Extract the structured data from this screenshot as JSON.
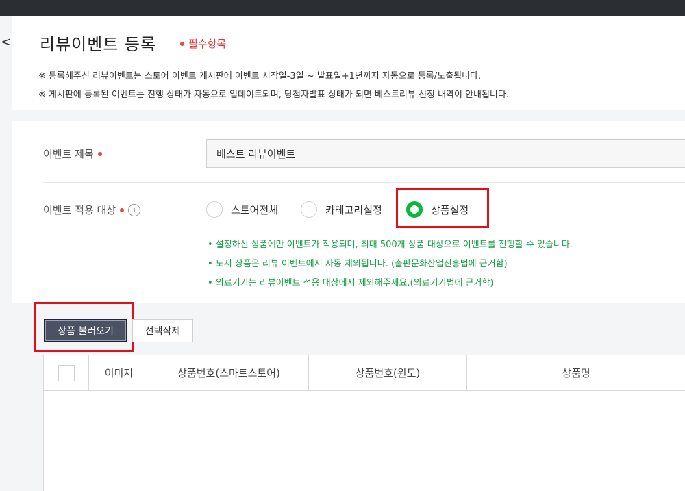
{
  "header": {
    "back_icon": "<",
    "title": "리뷰이벤트 등록",
    "required_legend": "필수항목",
    "notices": [
      "※ 등록해주신 리뷰이벤트는 스토어 이벤트 게시판에 이벤트 시작일-3일 ~ 발표일+1년까지 자동으로 등록/노출됩니다.",
      "※ 게시판에 등록된 이벤트는 진행 상태가 자동으로 업데이트되며, 당첨자발표 상태가 되면 베스트리뷰 선정 내역이 안내됩니다."
    ]
  },
  "form": {
    "event_title_label": "이벤트 제목",
    "event_title_value": "베스트 리뷰이벤트",
    "target_label": "이벤트 적용 대상",
    "info_icon": "i",
    "target_options": [
      "스토어전체",
      "카테고리설정",
      "상품설정"
    ],
    "selected_option": "상품설정",
    "guides": [
      "• 설정하신 상품에만 이벤트가 적용되며, 최대 500개 상품 대상으로 이벤트를 진행할 수 있습니다.",
      "• 도서 상품은 리뷰 이벤트에서 자동 제외됩니다. (출판문화산업진흥법에 근거함)",
      "• 의료기기는 리뷰이벤트 적용 대상에서 제외해주세요.(의료기기법에 근거함)"
    ]
  },
  "toolbar": {
    "load_products": "상품 불러오기",
    "delete_selected": "선택삭제"
  },
  "table": {
    "columns": [
      "이미지",
      "상품번호(스마트스토어)",
      "상품번호(윈도)",
      "상품명"
    ]
  },
  "colors": {
    "accent_green": "#09b83e",
    "guide_green": "#1aa04a",
    "required_red": "#e64646",
    "highlight_red": "#e0101c"
  }
}
